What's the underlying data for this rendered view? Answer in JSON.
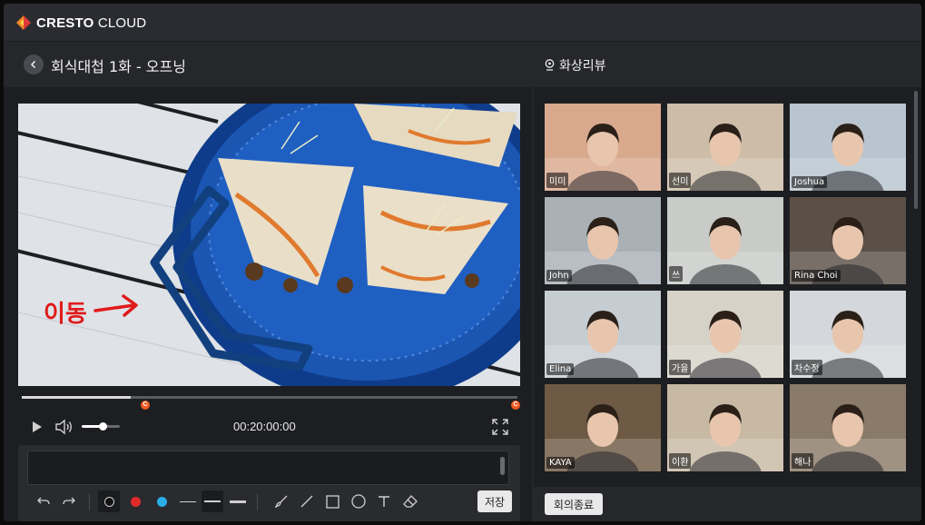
{
  "app": {
    "brand_bold": "CRESTO",
    "brand_light": "CLOUD"
  },
  "left_panel": {
    "title": "회식대첩 1화 - 오프닝",
    "annotation_text": "이동",
    "player": {
      "timecode": "00:20:00:00",
      "progress": 0.22,
      "volume": 0.55,
      "marker_label": "C"
    },
    "editor": {
      "comment_value": "",
      "save_label": "저장",
      "colors": {
        "black": "#111111",
        "red": "#e02b2b",
        "blue": "#2aaee6"
      }
    }
  },
  "right_panel": {
    "title": "화상리뷰",
    "participants": [
      {
        "name": "미미",
        "bg": "#d9a98e"
      },
      {
        "name": "선미",
        "bg": "#cdbda8"
      },
      {
        "name": "Joshua",
        "bg": "#b8c4cf"
      },
      {
        "name": "John",
        "bg": "#a9b0b6"
      },
      {
        "name": "쓰",
        "bg": "#c9cbc8"
      },
      {
        "name": "Rina Choi",
        "bg": "#5b5048"
      },
      {
        "name": "Elina",
        "bg": "#c6cdd2"
      },
      {
        "name": "가을",
        "bg": "#d6d2c8"
      },
      {
        "name": "차수정",
        "bg": "#d4d8dc"
      },
      {
        "name": "KAYA",
        "bg": "#6e5a44"
      },
      {
        "name": "이환",
        "bg": "#c7b9a4"
      },
      {
        "name": "해나",
        "bg": "#8a7a68"
      }
    ],
    "end_meeting_label": "회의종료"
  }
}
